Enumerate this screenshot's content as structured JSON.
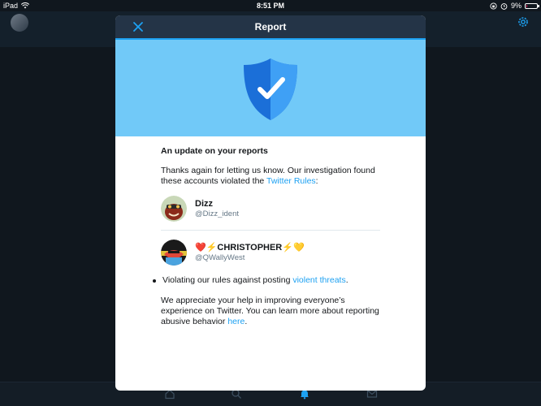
{
  "status_bar": {
    "device": "iPad",
    "time": "8:51 PM",
    "battery": "9%",
    "battery_level": 0.09
  },
  "modal": {
    "title": "Report",
    "close_icon": "close-icon",
    "hero_icon": "shield-check-icon"
  },
  "report": {
    "heading": "An update on your reports",
    "intro_before": "Thanks again for letting us know. Our investigation found these accounts violated the ",
    "intro_link": "Twitter Rules",
    "intro_after": ":",
    "accounts": [
      {
        "name": "Dizz",
        "handle": "@Dizz_ident"
      },
      {
        "name": "❤️⚡CHRISTOPHER⚡💛",
        "handle": "@QWallyWest"
      }
    ],
    "reason_before": "Violating our rules against posting ",
    "reason_link": "violent threats",
    "reason_after": ".",
    "closing_before": "We appreciate your help in improving everyone’s experience on Twitter. You can learn more about reporting abusive behavior ",
    "closing_link": "here",
    "closing_after": "."
  },
  "colors": {
    "accent": "#1da1f2",
    "header": "#243447",
    "hero": "#71c9f8"
  }
}
